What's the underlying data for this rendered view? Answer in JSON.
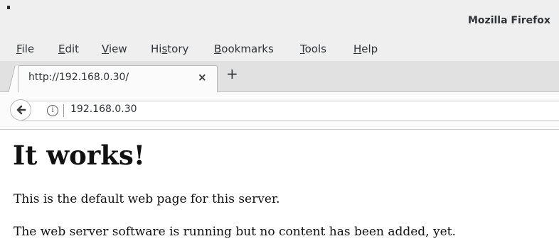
{
  "window": {
    "title": "Mozilla Firefox"
  },
  "menu": [
    {
      "pre": "",
      "acc": "F",
      "post": "ile"
    },
    {
      "pre": "",
      "acc": "E",
      "post": "dit"
    },
    {
      "pre": "",
      "acc": "V",
      "post": "iew"
    },
    {
      "pre": "Hi",
      "acc": "s",
      "post": "tory"
    },
    {
      "pre": "",
      "acc": "B",
      "post": "ookmarks"
    },
    {
      "pre": "",
      "acc": "T",
      "post": "ools"
    },
    {
      "pre": "",
      "acc": "H",
      "post": "elp"
    }
  ],
  "tab": {
    "title": "http://192.168.0.30/",
    "close": "×",
    "new_tab": "+"
  },
  "navbar": {
    "info_icon": "i",
    "url": "192.168.0.30"
  },
  "page": {
    "heading": "It works!",
    "para1": "This is the default web page for this server.",
    "para2": "The web server software is running but no content has been added, yet."
  },
  "icons": {
    "back": "back-arrow-icon",
    "info": "info-icon",
    "close": "close-icon",
    "new_tab": "plus-icon"
  }
}
